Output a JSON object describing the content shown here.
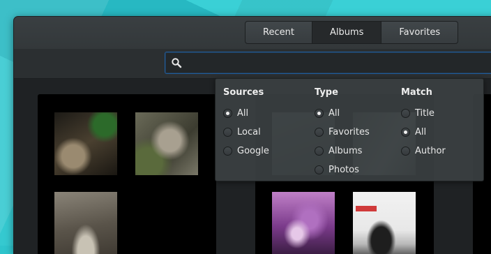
{
  "tabs": [
    {
      "label": "Recent",
      "active": false
    },
    {
      "label": "Albums",
      "active": true
    },
    {
      "label": "Favorites",
      "active": false
    }
  ],
  "search": {
    "value": "",
    "placeholder": ""
  },
  "filters": {
    "sources": {
      "heading": "Sources",
      "options": [
        "All",
        "Local",
        "Google"
      ],
      "selected": "All"
    },
    "type": {
      "heading": "Type",
      "options": [
        "All",
        "Favorites",
        "Albums",
        "Photos"
      ],
      "selected": "All"
    },
    "match": {
      "heading": "Match",
      "options": [
        "Title",
        "All",
        "Author"
      ],
      "selected": "All"
    }
  },
  "colors": {
    "accent": "#215d9c",
    "wallpaper": "#2ec4cc"
  }
}
